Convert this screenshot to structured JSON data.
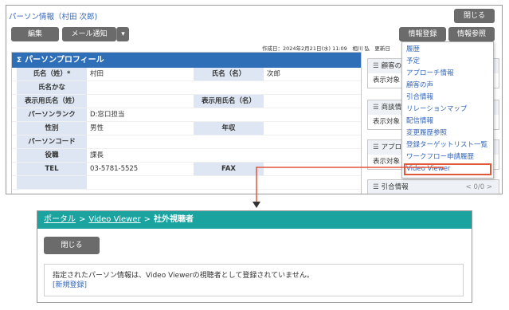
{
  "top": {
    "title": "パーソン情報（村田 次郎)",
    "close_label": "閉じる",
    "toolbar": {
      "edit_label": "編集",
      "mail_label": "メール通知",
      "mail_caret": "▾",
      "register_label": "情報登録",
      "reference_label": "情報参照"
    },
    "meta": {
      "created": "作成日：2024年2月21日(水) 11:09　相川 弘　更新日",
      "tail": "弘"
    },
    "profile": {
      "sigma": "Σ",
      "header": "パーソンプロフィール",
      "rows": [
        {
          "l_label": "氏名（姓）*",
          "l_value": "村田",
          "r_label": "氏名（名）",
          "r_value": "次郎"
        },
        {
          "l_label": "氏名かな",
          "l_value": "",
          "r_label": "",
          "r_value": ""
        },
        {
          "l_label": "表示用氏名（姓）",
          "l_value": "",
          "r_label": "表示用氏名（名）",
          "r_value": ""
        },
        {
          "l_label": "パーソンランク",
          "l_value": "D:窓口担当",
          "r_label": "",
          "r_value": ""
        },
        {
          "l_label": "性別",
          "l_value": "男性",
          "r_label": "年収",
          "r_value": ""
        },
        {
          "l_label": "パーソンコード",
          "l_value": "",
          "r_label": "",
          "r_value": ""
        },
        {
          "l_label": "役職",
          "l_value": "課長",
          "r_label": "",
          "r_value": ""
        },
        {
          "l_label": "TEL",
          "l_value": "03-5781-5525",
          "r_label": "FAX",
          "r_value": ""
        },
        {
          "l_label": "",
          "l_value": "",
          "r_label": "",
          "r_value": ""
        }
      ]
    },
    "side_panels": [
      {
        "icon": "☰",
        "title": "顧客の",
        "body": "表示対象"
      },
      {
        "icon": "☰",
        "title": "商談情",
        "body": "表示対象"
      },
      {
        "icon": "☰",
        "title": "アプロ",
        "body": "表示対象"
      },
      {
        "icon": "☰",
        "title": "引合情報",
        "body": "",
        "pager": "< 0/0 >"
      }
    ],
    "menu": [
      "履歴",
      "予定",
      "アプローチ情報",
      "顧客の声",
      "引合情報",
      "リレーションマップ",
      "配信情報",
      "変更履歴参照",
      "登録ターゲットリスト一覧",
      "ワークフロー申請履歴",
      "Video Viewer"
    ]
  },
  "bottom": {
    "breadcrumb": {
      "portal": "ポータル",
      "sep": ">",
      "video_viewer": "Video Viewer",
      "sep2": ">",
      "current": "社外視聴者"
    },
    "close_label": "閉じる",
    "message": "指定されたパーソン情報は、Video Viewerの視聴者として登録されていません。",
    "register_link": "[新規登録]"
  },
  "colors": {
    "profile_header": "#2e6fb8",
    "label_bg": "#dde6f2",
    "teal_header": "#1ba3a0",
    "highlight": "#e0573a",
    "dark_button": "#6b6b6b",
    "link": "#3366bb"
  }
}
